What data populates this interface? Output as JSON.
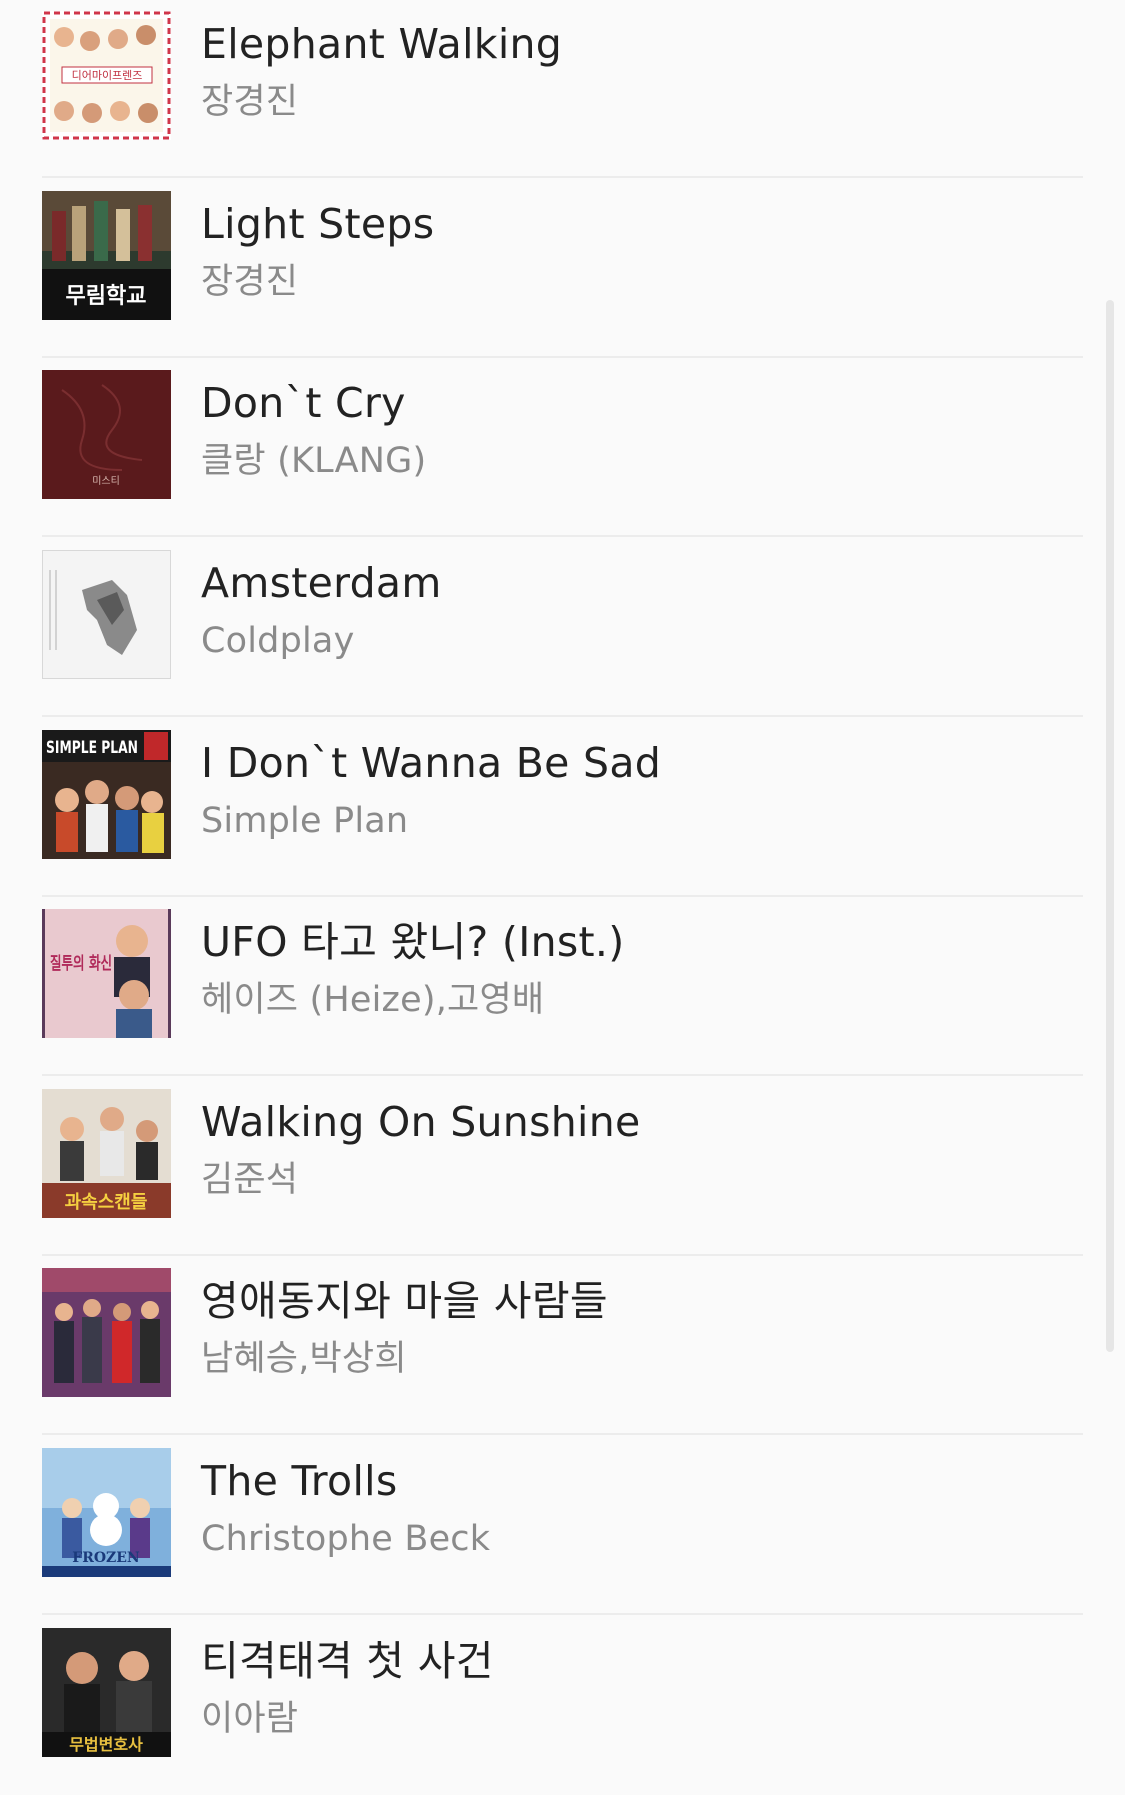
{
  "tracks": [
    {
      "title": "Elephant Walking",
      "artist": "장경진",
      "cover": "dear-my-friends-ost-cover",
      "cover_text": "디어마이프렌즈"
    },
    {
      "title": "Light Steps",
      "artist": "장경진",
      "cover": "murim-school-cover",
      "cover_text": "무림학교"
    },
    {
      "title": "Don`t Cry",
      "artist": "클랑 (KLANG)",
      "cover": "mistress-cover",
      "cover_text": "미스티"
    },
    {
      "title": "Amsterdam",
      "artist": "Coldplay",
      "cover": "coldplay-heart-cover",
      "cover_text": ""
    },
    {
      "title": "I Don`t Wanna Be Sad",
      "artist": "Simple Plan",
      "cover": "simple-plan-cover",
      "cover_text": "SIMPLE PLAN"
    },
    {
      "title": "UFO 타고 왔니? (Inst.)",
      "artist": "헤이즈 (Heize),고영배",
      "cover": "jealousy-incarnate-cover",
      "cover_text": "질투의 화신"
    },
    {
      "title": "Walking On Sunshine",
      "artist": "김준석",
      "cover": "scandal-cover",
      "cover_text": "과속스캔들"
    },
    {
      "title": "영애동지와 마을 사람들",
      "artist": "남혜승,박상희",
      "cover": "village-people-cover",
      "cover_text": ""
    },
    {
      "title": "The Trolls",
      "artist": "Christophe Beck",
      "cover": "frozen-cover",
      "cover_text": "FROZEN"
    },
    {
      "title": "티격태격 첫 사건",
      "artist": "이아람",
      "cover": "lawless-lawyer-cover",
      "cover_text": "무법변호사"
    }
  ],
  "colors": {
    "title": "#222222",
    "artist": "#8a8a8a",
    "divider": "#ececec",
    "background": "#fafafa"
  }
}
